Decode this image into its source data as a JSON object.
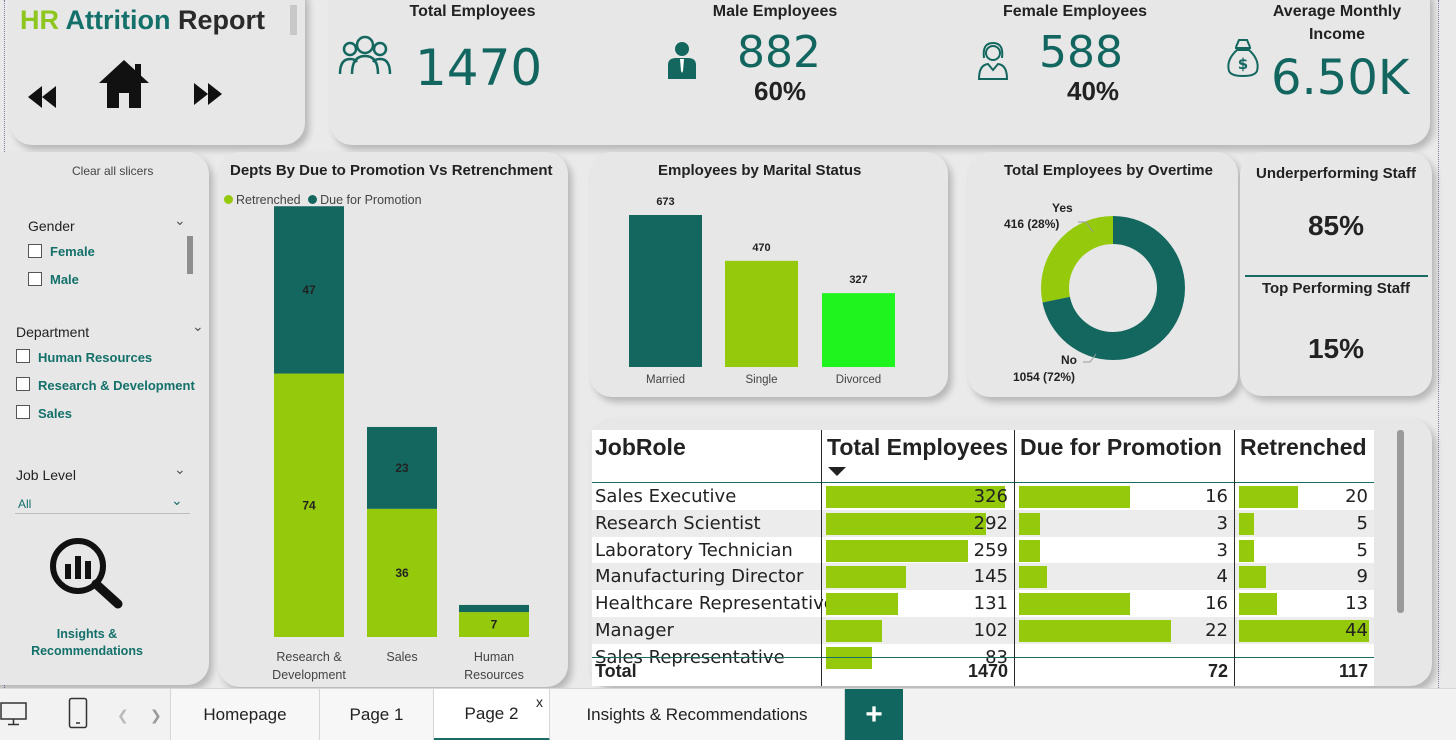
{
  "report": {
    "title_hr": "HR",
    "title_attrition": "Attrition",
    "title_report": "Report"
  },
  "kpis": {
    "total_employees": {
      "label": "Total Employees",
      "value": "1470"
    },
    "male_employees": {
      "label": "Male Employees",
      "value": "882",
      "pct": "60%"
    },
    "female_employees": {
      "label": "Female Employees",
      "value": "588",
      "pct": "40%"
    },
    "avg_income": {
      "label_line1": "Average Monthly",
      "label_line2": "Income",
      "value": "6.50K"
    }
  },
  "slicers": {
    "clear_label": "Clear all slicers",
    "gender": {
      "label": "Gender",
      "options": [
        "Female",
        "Male"
      ]
    },
    "department": {
      "label": "Department",
      "options": [
        "Human Resources",
        "Research & Development",
        "Sales"
      ]
    },
    "job_level": {
      "label": "Job Level",
      "value": "All"
    },
    "insights_line1": "Insights &",
    "insights_line2": "Recommendations"
  },
  "dept_chart_title": "Depts By Due to Promotion Vs Retrenchment",
  "marital_chart_title": "Employees by Marital Status",
  "overtime_chart_title": "Total Employees by Overtime",
  "performance": {
    "underperforming_label": "Underperforming Staff",
    "underperforming_value": "85%",
    "top_label": "Top Performing Staff",
    "top_value": "15%"
  },
  "chart_data": [
    {
      "type": "bar",
      "stacked": true,
      "title": "Depts By Due to Promotion Vs Retrenchment",
      "categories": [
        "Research & Development",
        "Sales",
        "Human Resources"
      ],
      "category_lines": [
        [
          "Research &",
          "Development"
        ],
        [
          "Sales"
        ],
        [
          "Human",
          "Resources"
        ]
      ],
      "series": [
        {
          "name": "Retrenched",
          "values": [
            74,
            36,
            7
          ],
          "color": "#95c90c"
        },
        {
          "name": "Due for Promotion",
          "values": [
            47,
            23,
            2
          ],
          "color": "#13675f"
        }
      ],
      "value_labels": [
        [
          "74",
          "36",
          "7"
        ],
        [
          "47",
          "23",
          ""
        ]
      ],
      "legend_position": "top-left",
      "ylim": [
        0,
        125
      ]
    },
    {
      "type": "bar",
      "title": "Employees by Marital Status",
      "categories": [
        "Married",
        "Single",
        "Divorced"
      ],
      "values": [
        673,
        470,
        327
      ],
      "colors": [
        "#13675f",
        "#95c90c",
        "#1ff41f"
      ],
      "ylim": [
        0,
        730
      ]
    },
    {
      "type": "pie",
      "donut": true,
      "title": "Total Employees by Overtime",
      "categories": [
        "Yes",
        "No"
      ],
      "values": [
        416,
        1054
      ],
      "percents": [
        28,
        72
      ],
      "labels": [
        "416 (28%)",
        "1054 (72%)"
      ],
      "colors": [
        "#95c90c",
        "#13675f"
      ]
    }
  ],
  "table": {
    "headers": [
      "JobRole",
      "Total Employees",
      "Due for Promotion",
      "Retrenched"
    ],
    "bar_color": "#95c90c",
    "max": {
      "total": 326,
      "promotion": 22,
      "retrenched": 44
    },
    "rows": [
      {
        "role": "Sales Executive",
        "total": 326,
        "promotion": 16,
        "retrenched": 20
      },
      {
        "role": "Research Scientist",
        "total": 292,
        "promotion": 3,
        "retrenched": 5
      },
      {
        "role": "Laboratory Technician",
        "total": 259,
        "promotion": 3,
        "retrenched": 5
      },
      {
        "role": "Manufacturing Director",
        "total": 145,
        "promotion": 4,
        "retrenched": 9
      },
      {
        "role": "Healthcare Representative",
        "total": 131,
        "promotion": 16,
        "retrenched": 13
      },
      {
        "role": "Manager",
        "total": 102,
        "promotion": 22,
        "retrenched": 44
      },
      {
        "role": "Sales Representative",
        "total": 83,
        "promotion": "",
        "retrenched": ""
      }
    ],
    "totals": {
      "label": "Total",
      "total": "1470",
      "promotion": "72",
      "retrenched": "117"
    }
  },
  "tabs": {
    "items": [
      "Homepage",
      "Page 1",
      "Page 2",
      "Insights & Recommendations"
    ],
    "active": "Page 2",
    "close_label": "x",
    "add_label": "+"
  },
  "icons": {
    "rewind": "rewind-icon",
    "home": "home-icon",
    "fast_forward": "fast-forward-icon",
    "group": "group-icon",
    "male": "male-user-icon",
    "female": "female-user-icon",
    "money_bag": "money-bag-icon",
    "insights": "insights-magnifier-icon",
    "desktop": "desktop-icon",
    "mobile": "mobile-icon"
  }
}
